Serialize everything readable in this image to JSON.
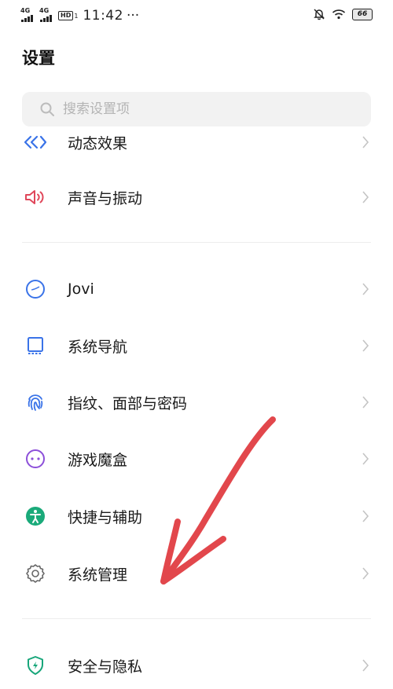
{
  "status_bar": {
    "signal_1": "4G",
    "signal_2": "4G",
    "hd_label": "HD",
    "hd_sub": "1",
    "time": "11:42",
    "more": "···",
    "battery": "66",
    "icons": [
      "silent-bell-icon",
      "wifi-icon",
      "battery-icon"
    ]
  },
  "page": {
    "title": "设置"
  },
  "search": {
    "placeholder": "搜索设置项"
  },
  "settings": {
    "items": [
      {
        "label": "动态效果",
        "icon": "dynamic-effects-icon",
        "color": "#3a73e8"
      },
      {
        "label": "声音与振动",
        "icon": "speaker-icon",
        "color": "#e0475a"
      },
      {
        "label": "Jovi",
        "icon": "jovi-icon",
        "color": "#3a73e8"
      },
      {
        "label": "系统导航",
        "icon": "navigation-icon",
        "color": "#3a73e8"
      },
      {
        "label": "指纹、面部与密码",
        "icon": "fingerprint-icon",
        "color": "#3a73e8"
      },
      {
        "label": "游戏魔盒",
        "icon": "game-box-icon",
        "color": "#8c4fd9"
      },
      {
        "label": "快捷与辅助",
        "icon": "accessibility-icon",
        "color": "#1aaa7a"
      },
      {
        "label": "系统管理",
        "icon": "gear-icon",
        "color": "#666666"
      },
      {
        "label": "安全与隐私",
        "icon": "shield-icon",
        "color": "#17a67a"
      }
    ]
  },
  "colors": {
    "annotation_arrow": "#e2474c",
    "chevron": "#c4c4c4"
  }
}
